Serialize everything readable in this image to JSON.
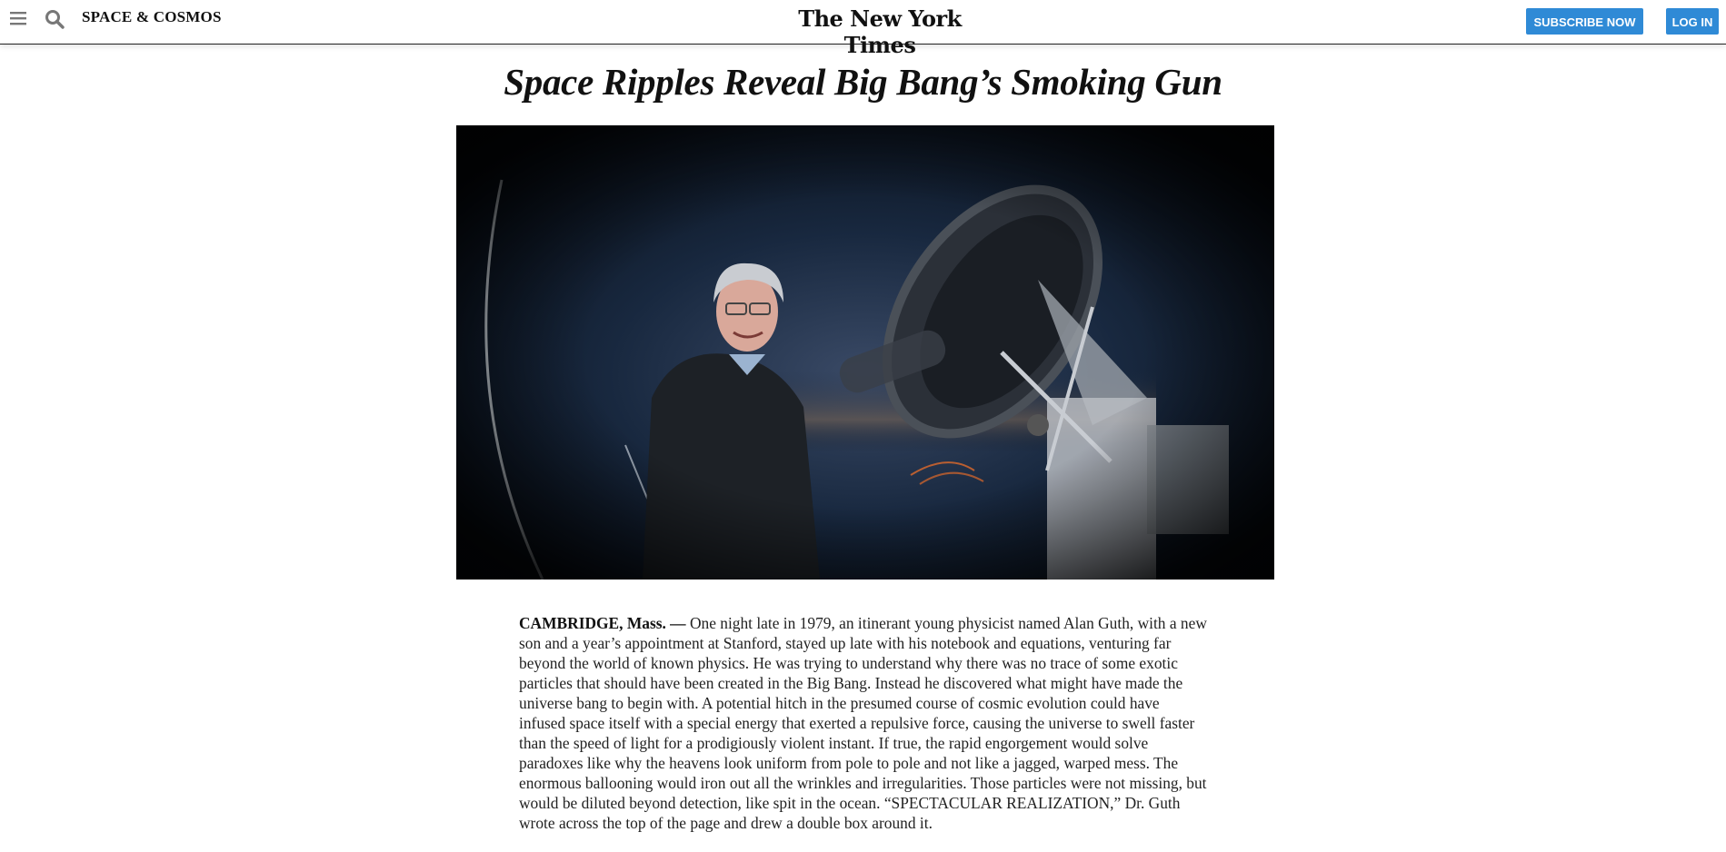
{
  "header": {
    "section": "SPACE & COSMOS",
    "logo": "The New York Times",
    "subscribe_label": "SUBSCRIBE NOW",
    "login_label": "LOG IN",
    "accent_color": "#2f8ad6"
  },
  "article": {
    "headline": "Space Ripples Reveal Big Bang’s Smoking Gun",
    "dateline": "CAMBRIDGE, Mass. —",
    "body": "One night late in 1979, an itinerant young physicist named Alan Guth, with a new son and a year’s appointment at Stanford, stayed up late with his notebook and equations, venturing far beyond the world of known physics. He was trying to understand why there was no trace of some exotic particles that should have been created in the Big Bang. Instead he discovered what might have made the universe bang to begin with. A potential hitch in the presumed course of cosmic evolution could have infused space itself with a special energy that exerted a repulsive force, causing the universe to swell faster than the speed of light for a prodigiously violent instant. If true, the rapid engorgement would solve paradoxes like why the heavens look uniform from pole to pole and not like a jagged, warped mess. The enormous ballooning would iron out all the wrinkles and irregularities. Those particles were not missing, but would be diluted beyond detection, like spit in the ocean. “SPECTACULAR REALIZATION,” Dr. Guth wrote across the top of the page and drew a double box around it."
  },
  "icons": {
    "menu": "hamburger-menu-icon",
    "search": "search-icon"
  }
}
